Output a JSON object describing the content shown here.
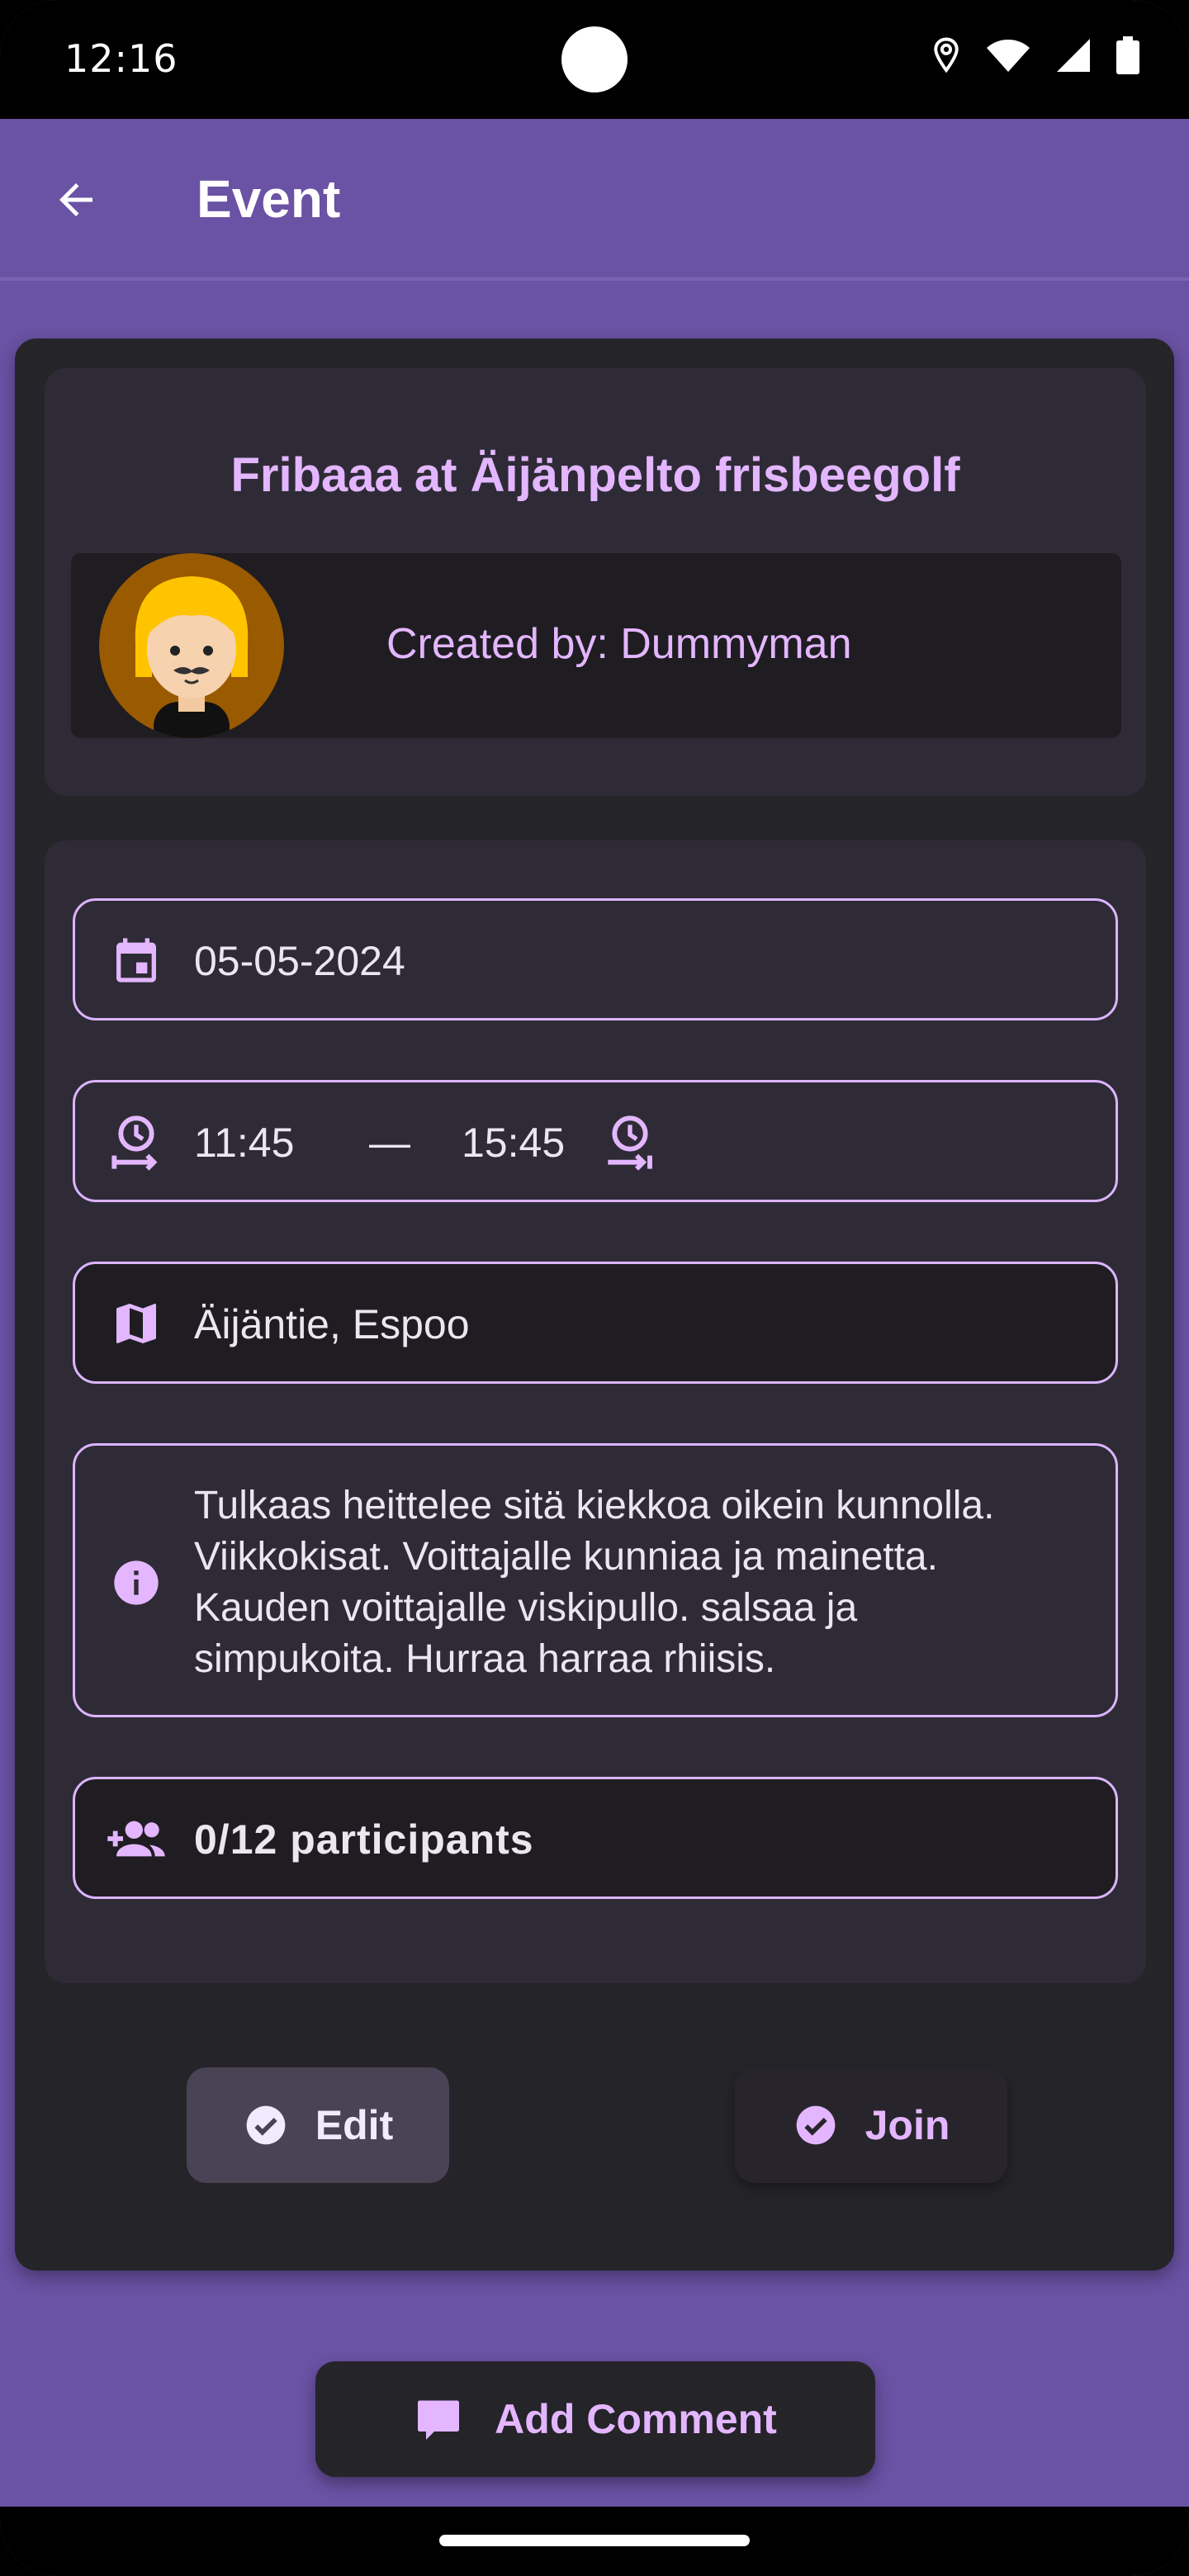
{
  "status": {
    "time": "12:16"
  },
  "appbar": {
    "title": "Event"
  },
  "event": {
    "title": "Fribaaa at Äijänpelto frisbeegolf",
    "creator": "Created by: Dummyman",
    "date": "05-05-2024",
    "time_start": "11:45",
    "time_separator": "—",
    "time_end": "15:45",
    "location": "Äijäntie, Espoo",
    "description_lines": [
      "Tulkaas heittelee sitä kiekkoa oikein kunnolla.",
      "Viikkokisat. Voittajalle kunniaa ja mainetta.",
      "Kauden voittajalle viskipullo. salsaa ja",
      "simpukoita. Hurraa harraa rhiisis."
    ],
    "participants": "0/12 participants"
  },
  "actions": {
    "edit_label": "Edit",
    "join_label": "Join",
    "comment_label": "Add Comment"
  },
  "colors": {
    "primary": "#6a52a4",
    "accent_text": "#e3b6ff",
    "card_bg": "#252429",
    "inner_card_bg": "#2e2b36",
    "field_border": "#dcb4ff"
  },
  "icons": {
    "back": "arrow-left-icon",
    "date": "calendar-icon",
    "time_start": "timer-start-icon",
    "time_end": "timer-end-icon",
    "location": "map-icon",
    "info": "info-icon",
    "participants": "group-add-icon",
    "edit": "check-circle-icon",
    "join": "check-circle-icon",
    "comment": "comment-icon"
  }
}
